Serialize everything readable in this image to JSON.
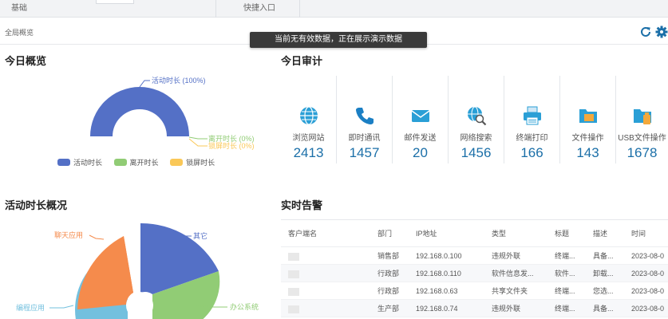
{
  "topbar": {
    "tab1": "基础",
    "tab2": "快捷入口"
  },
  "crumb": "全局概览",
  "toast": "当前无有效数据，正在展示演示数据",
  "overview": {
    "title": "今日概览",
    "active_label": "活动时长 (100%)",
    "away_label": "离开时长 (0%)",
    "lock_label": "锁屏时长 (0%)",
    "legend": [
      "活动时长",
      "离开时长",
      "锁屏时长"
    ]
  },
  "audit": {
    "title": "今日审计",
    "items": [
      {
        "name": "浏览网站",
        "value": "2413"
      },
      {
        "name": "即时通讯",
        "value": "1457"
      },
      {
        "name": "邮件发送",
        "value": "20"
      },
      {
        "name": "网络搜索",
        "value": "1456"
      },
      {
        "name": "终端打印",
        "value": "166"
      },
      {
        "name": "文件操作",
        "value": "143"
      },
      {
        "name": "USB文件操作",
        "value": "1678"
      }
    ]
  },
  "activity": {
    "title": "活动时长概况",
    "labels": {
      "other": "其它",
      "chat": "聊天应用",
      "programming": "编程应用",
      "office": "办公系统"
    }
  },
  "alerts": {
    "title": "实时告警",
    "headers": [
      "客户端名",
      "部门",
      "IP地址",
      "类型",
      "标题",
      "描述",
      "时间"
    ],
    "rows": [
      {
        "dept": "销售部",
        "ip": "192.168.0.100",
        "type": "违规外联",
        "title": "终端...",
        "desc": "具备...",
        "time": "2023-08-0"
      },
      {
        "dept": "行政部",
        "ip": "192.168.0.110",
        "type": "软件信息发...",
        "title": "软件...",
        "desc": "卸载...",
        "time": "2023-08-0"
      },
      {
        "dept": "行政部",
        "ip": "192.168.0.63",
        "type": "共享文件夹",
        "title": "终端...",
        "desc": "您选...",
        "time": "2023-08-0"
      },
      {
        "dept": "生产部",
        "ip": "192.168.0.74",
        "type": "违规外联",
        "title": "终端...",
        "desc": "具备...",
        "time": "2023-08-0"
      }
    ]
  },
  "colors": {
    "blue": "#5470c6",
    "green": "#91cc75",
    "yellow": "#fac858",
    "orange": "#f58b4c",
    "lightblue": "#73c0de",
    "accent_number": "#1b6fa8"
  }
}
